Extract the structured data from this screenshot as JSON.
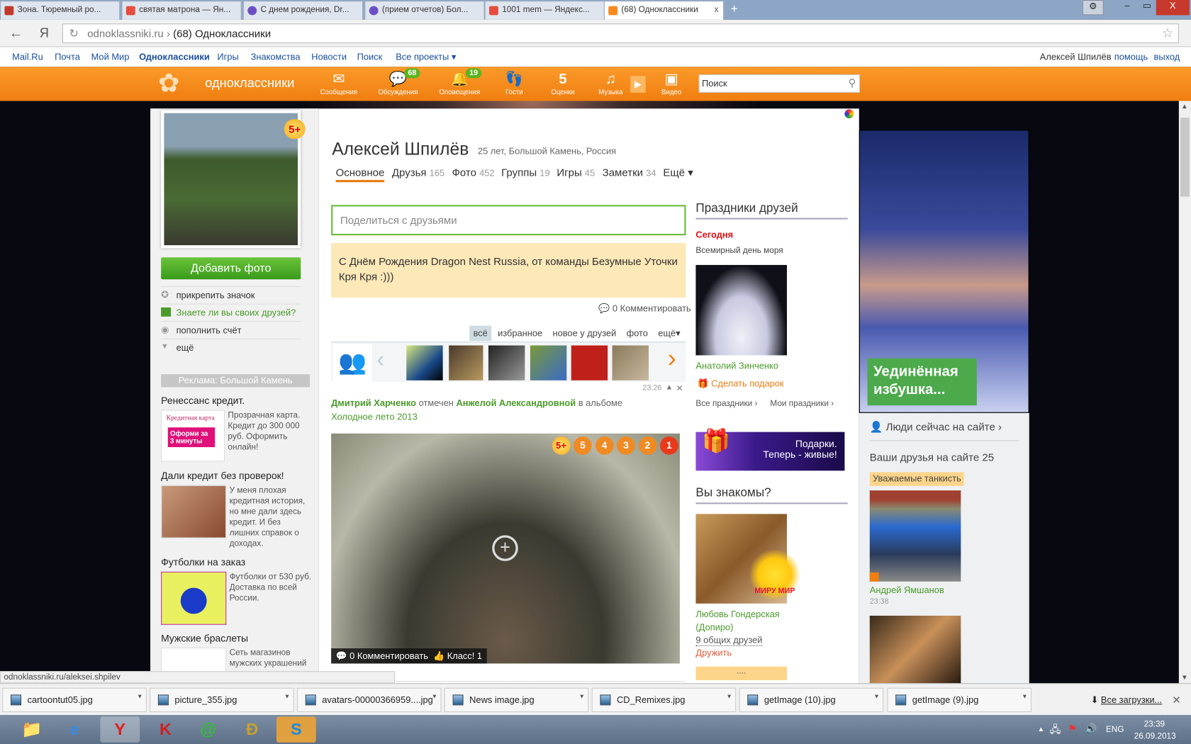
{
  "browser": {
    "tabs": [
      {
        "label": "Зона. Тюремный ро...",
        "color": "#c0392b"
      },
      {
        "label": "святая матрона — Ян...",
        "color": "#e74c3c"
      },
      {
        "label": "С днем рождения, Dr...",
        "color": "#6c4fc4"
      },
      {
        "label": "(прием отчетов) Бол...",
        "color": "#6c4fc4"
      },
      {
        "label": "1001 mem — Яндекс...",
        "color": "#e74c3c"
      },
      {
        "label": "(68) Одноклассники",
        "color": "#f68a1e",
        "active": true
      }
    ],
    "new_tab": "+",
    "url_domain": "odnoklassniki.ru",
    "url_sep": "›",
    "url_title": "(68) Одноклассники",
    "back": "←",
    "yandex": "Я",
    "reload": "↻",
    "star": "☆",
    "window": {
      "settings": "⚙",
      "min": "‒",
      "max": "▭",
      "close": "X"
    }
  },
  "mailbar": {
    "links": [
      "Mail.Ru",
      "Почта",
      "Мой Мир",
      "Одноклассники",
      "Игры",
      "Знакомства",
      "Новости",
      "Поиск",
      "Все проекты ▾"
    ],
    "user": "Алексей Шпилёв",
    "help": "помощь",
    "logout": "выход"
  },
  "okbar": {
    "logo": "одноклассники",
    "nav": [
      {
        "label": "Сообщения",
        "icon": "✉"
      },
      {
        "label": "Обсуждения",
        "icon": "💬",
        "badge": "68"
      },
      {
        "label": "Оповещения",
        "icon": "🔔",
        "badge": "19"
      },
      {
        "label": "Гости",
        "icon": "👣"
      },
      {
        "label": "Оценки",
        "icon": "5"
      },
      {
        "label": "Музыка",
        "icon": "♫"
      },
      {
        "label": "Видео",
        "icon": "▣"
      }
    ],
    "search_placeholder": "Поиск"
  },
  "left": {
    "rating_badge": "5+",
    "add_photo": "Добавить фото",
    "menu": [
      "прикрепить значок",
      "Знаете ли вы своих друзей?",
      "пополнить счёт",
      "ещё"
    ],
    "ads_header": "Реклама: Большой Камень",
    "ads": [
      {
        "title": "Ренессанс кредит.",
        "text": "Прозрачная карта. Кредит до 300 000 руб. Оформить онлайн!",
        "img_line1": "Кредитная карта",
        "img_line2": "Оформи за 3 минуты"
      },
      {
        "title": "Дали кредит без проверок!",
        "text": "У меня плохая кредитная история, но мне дали здесь кредит. И без лишних справок о доходах."
      },
      {
        "title": "Футболки на заказ",
        "text": "Футболки от 530 руб. Доставка по всей России."
      },
      {
        "title": "Мужские браслеты",
        "text": "Сеть магазинов мужских украшений"
      }
    ]
  },
  "profile": {
    "name": "Алексей Шпилёв",
    "info": "25 лет, Большой Камень, Россия",
    "tabs": [
      {
        "label": "Основное",
        "count": ""
      },
      {
        "label": "Друзья",
        "count": "165"
      },
      {
        "label": "Фото",
        "count": "452"
      },
      {
        "label": "Группы",
        "count": "19"
      },
      {
        "label": "Игры",
        "count": "45"
      },
      {
        "label": "Заметки",
        "count": "34"
      },
      {
        "label": "Ещё ▾",
        "count": ""
      }
    ]
  },
  "feed": {
    "share_placeholder": "Поделиться с друзьями",
    "status": "С Днём Рождения Dragon Nest Russia, от команды Безумные Уточки Кря Кря :)))",
    "status_comment": "0 Комментировать",
    "filters": [
      "всё",
      "избранное",
      "новое у друзей",
      "фото",
      "ещё▾"
    ],
    "time": "23:26",
    "event": {
      "user": "Дмитрий Харченко",
      "verb": "отмечен",
      "by": "Анжелой Александровной",
      "in": "в альбоме",
      "album": "Холодное лето 2013"
    },
    "photo_ratings": [
      "5+",
      "5",
      "4",
      "3",
      "2",
      "1"
    ],
    "photo_comment": "0 Комментировать",
    "photo_like": "Класс! 1"
  },
  "holidays": {
    "title": "Праздники друзей",
    "today": "Сегодня",
    "event": "Всемирный день моря",
    "person": "Анатолий Зинченко",
    "gift": "Сделать подарок",
    "all": "Все праздники ›",
    "mine": "Мои праздники ›"
  },
  "gifts_banner": {
    "line1": "Подарки.",
    "line2": "Теперь - живые!"
  },
  "know": {
    "title": "Вы знакомы?",
    "sticker": "МИРУ МИР",
    "name": "Любовь Гондерская (Допиро)",
    "mutual": "9 общих друзей",
    "add": "Дружить",
    "more": "...."
  },
  "right": {
    "ad_text": "Уединённая избушка...",
    "online": "Люди сейчас на сайте ›",
    "friends_online": "Ваши друзья на сайте",
    "friends_count": "25",
    "bubble": "Уважаемые танкисть",
    "friend": "Андрей Ямшанов",
    "friend_time": "23:38"
  },
  "status_url": "odnoklassniki.ru/aleksei.shpilev",
  "downloads": {
    "files": [
      "cartoontut05.jpg",
      "picture_355.jpg",
      "avatars-00000366959....jpg",
      "News image.jpg",
      "CD_Remixes.jpg",
      "getImage (10).jpg",
      "getImage (9).jpg"
    ],
    "all": "Все загрузки...",
    "close": "✕"
  },
  "taskbar": {
    "lang": "ENG",
    "time": "23:39",
    "date": "26.09.2013"
  }
}
